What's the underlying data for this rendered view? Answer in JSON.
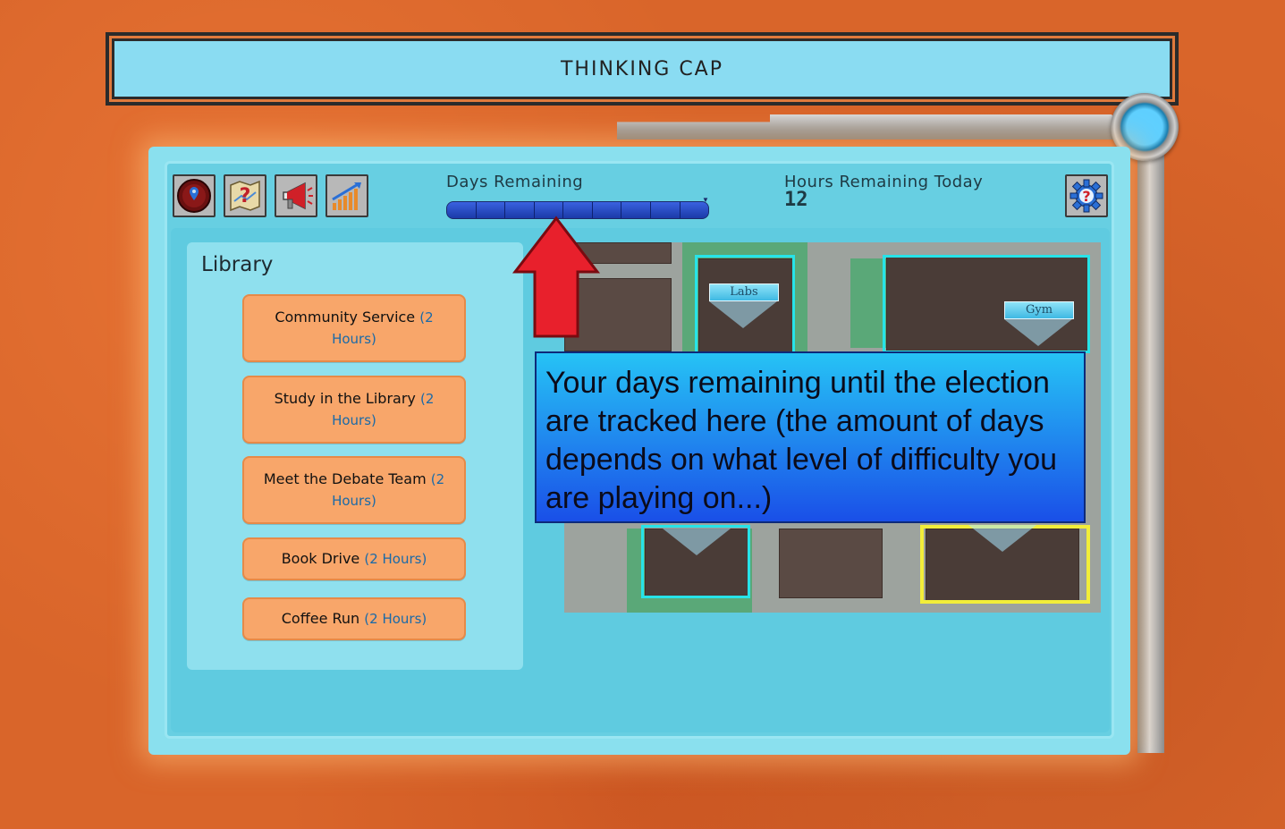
{
  "title": "THINKING CAP",
  "toolbar": {
    "icons": [
      "map-pin-icon",
      "help-map-icon",
      "megaphone-icon",
      "stats-chart-icon"
    ],
    "settings_icon": "help-gear-icon"
  },
  "days": {
    "label": "Days Remaining",
    "segments_total": 9,
    "bar_color": "#1d3fb6"
  },
  "hours": {
    "label": "Hours Remaining Today",
    "value": "12"
  },
  "library": {
    "title": "Library",
    "activities": [
      {
        "name": "Community Service",
        "hours": "(2 Hours)"
      },
      {
        "name": "Study in the Library",
        "hours": "(2 Hours)"
      },
      {
        "name": "Meet the Debate Team",
        "hours": "(2 Hours)"
      },
      {
        "name": "Book Drive",
        "hours": "(2 Hours)"
      },
      {
        "name": "Coffee Run",
        "hours": "(2 Hours)"
      }
    ]
  },
  "map": {
    "labels": {
      "labs": "Labs",
      "gym": "Gym"
    }
  },
  "tooltip": {
    "text": "Your days remaining until the election are tracked here (the amount of days depends on what level of difficulty you are playing on...)"
  },
  "colors": {
    "background": "#d9652a",
    "panel": "#8ae0ee",
    "activity_button": "#f8a66a",
    "tooltip_top": "#26c3f5",
    "tooltip_bottom": "#1a4fe8",
    "arrow": "#e8202c"
  }
}
